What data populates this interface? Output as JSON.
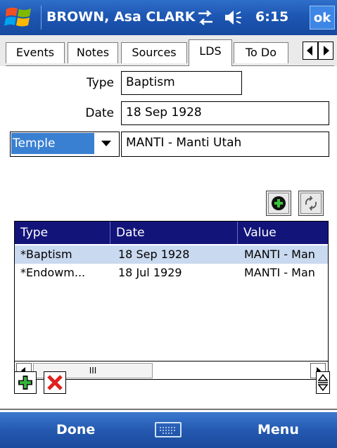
{
  "titlebar": {
    "title": "BROWN, Asa CLARK",
    "time": "6:15",
    "ok_label": "ok"
  },
  "tabs": {
    "items": [
      {
        "label": "Events"
      },
      {
        "label": "Notes"
      },
      {
        "label": "Sources"
      },
      {
        "label": "LDS"
      },
      {
        "label": "To Do"
      }
    ],
    "active": "LDS"
  },
  "form": {
    "type_label": "Type",
    "type_value": "Baptism",
    "date_label": "Date",
    "date_value": "18 Sep 1928",
    "place_type_selected": "Temple",
    "place_value": "MANTI - Manti Utah"
  },
  "list": {
    "columns": [
      "Type",
      "Date",
      "Value"
    ],
    "rows": [
      {
        "type": "*Baptism",
        "date": "18 Sep 1928",
        "value": "MANTI - Man",
        "selected": true
      },
      {
        "type": "*Endowm...",
        "date": "18 Jul 1929",
        "value": "MANTI - Man",
        "selected": false
      }
    ],
    "scroll_thumb_glyph": "III"
  },
  "softkeys": {
    "left": "Done",
    "right": "Menu"
  },
  "colors": {
    "title_bar": "#1d56b3",
    "header": "#13147a",
    "selection": "#c9d9ef",
    "select_highlight": "#3a80d2"
  },
  "icons": [
    "windows-start-icon",
    "connectivity-icon",
    "volume-icon",
    "add-place-icon",
    "refresh-place-icon",
    "add-icon",
    "delete-icon",
    "keyboard-icon"
  ]
}
